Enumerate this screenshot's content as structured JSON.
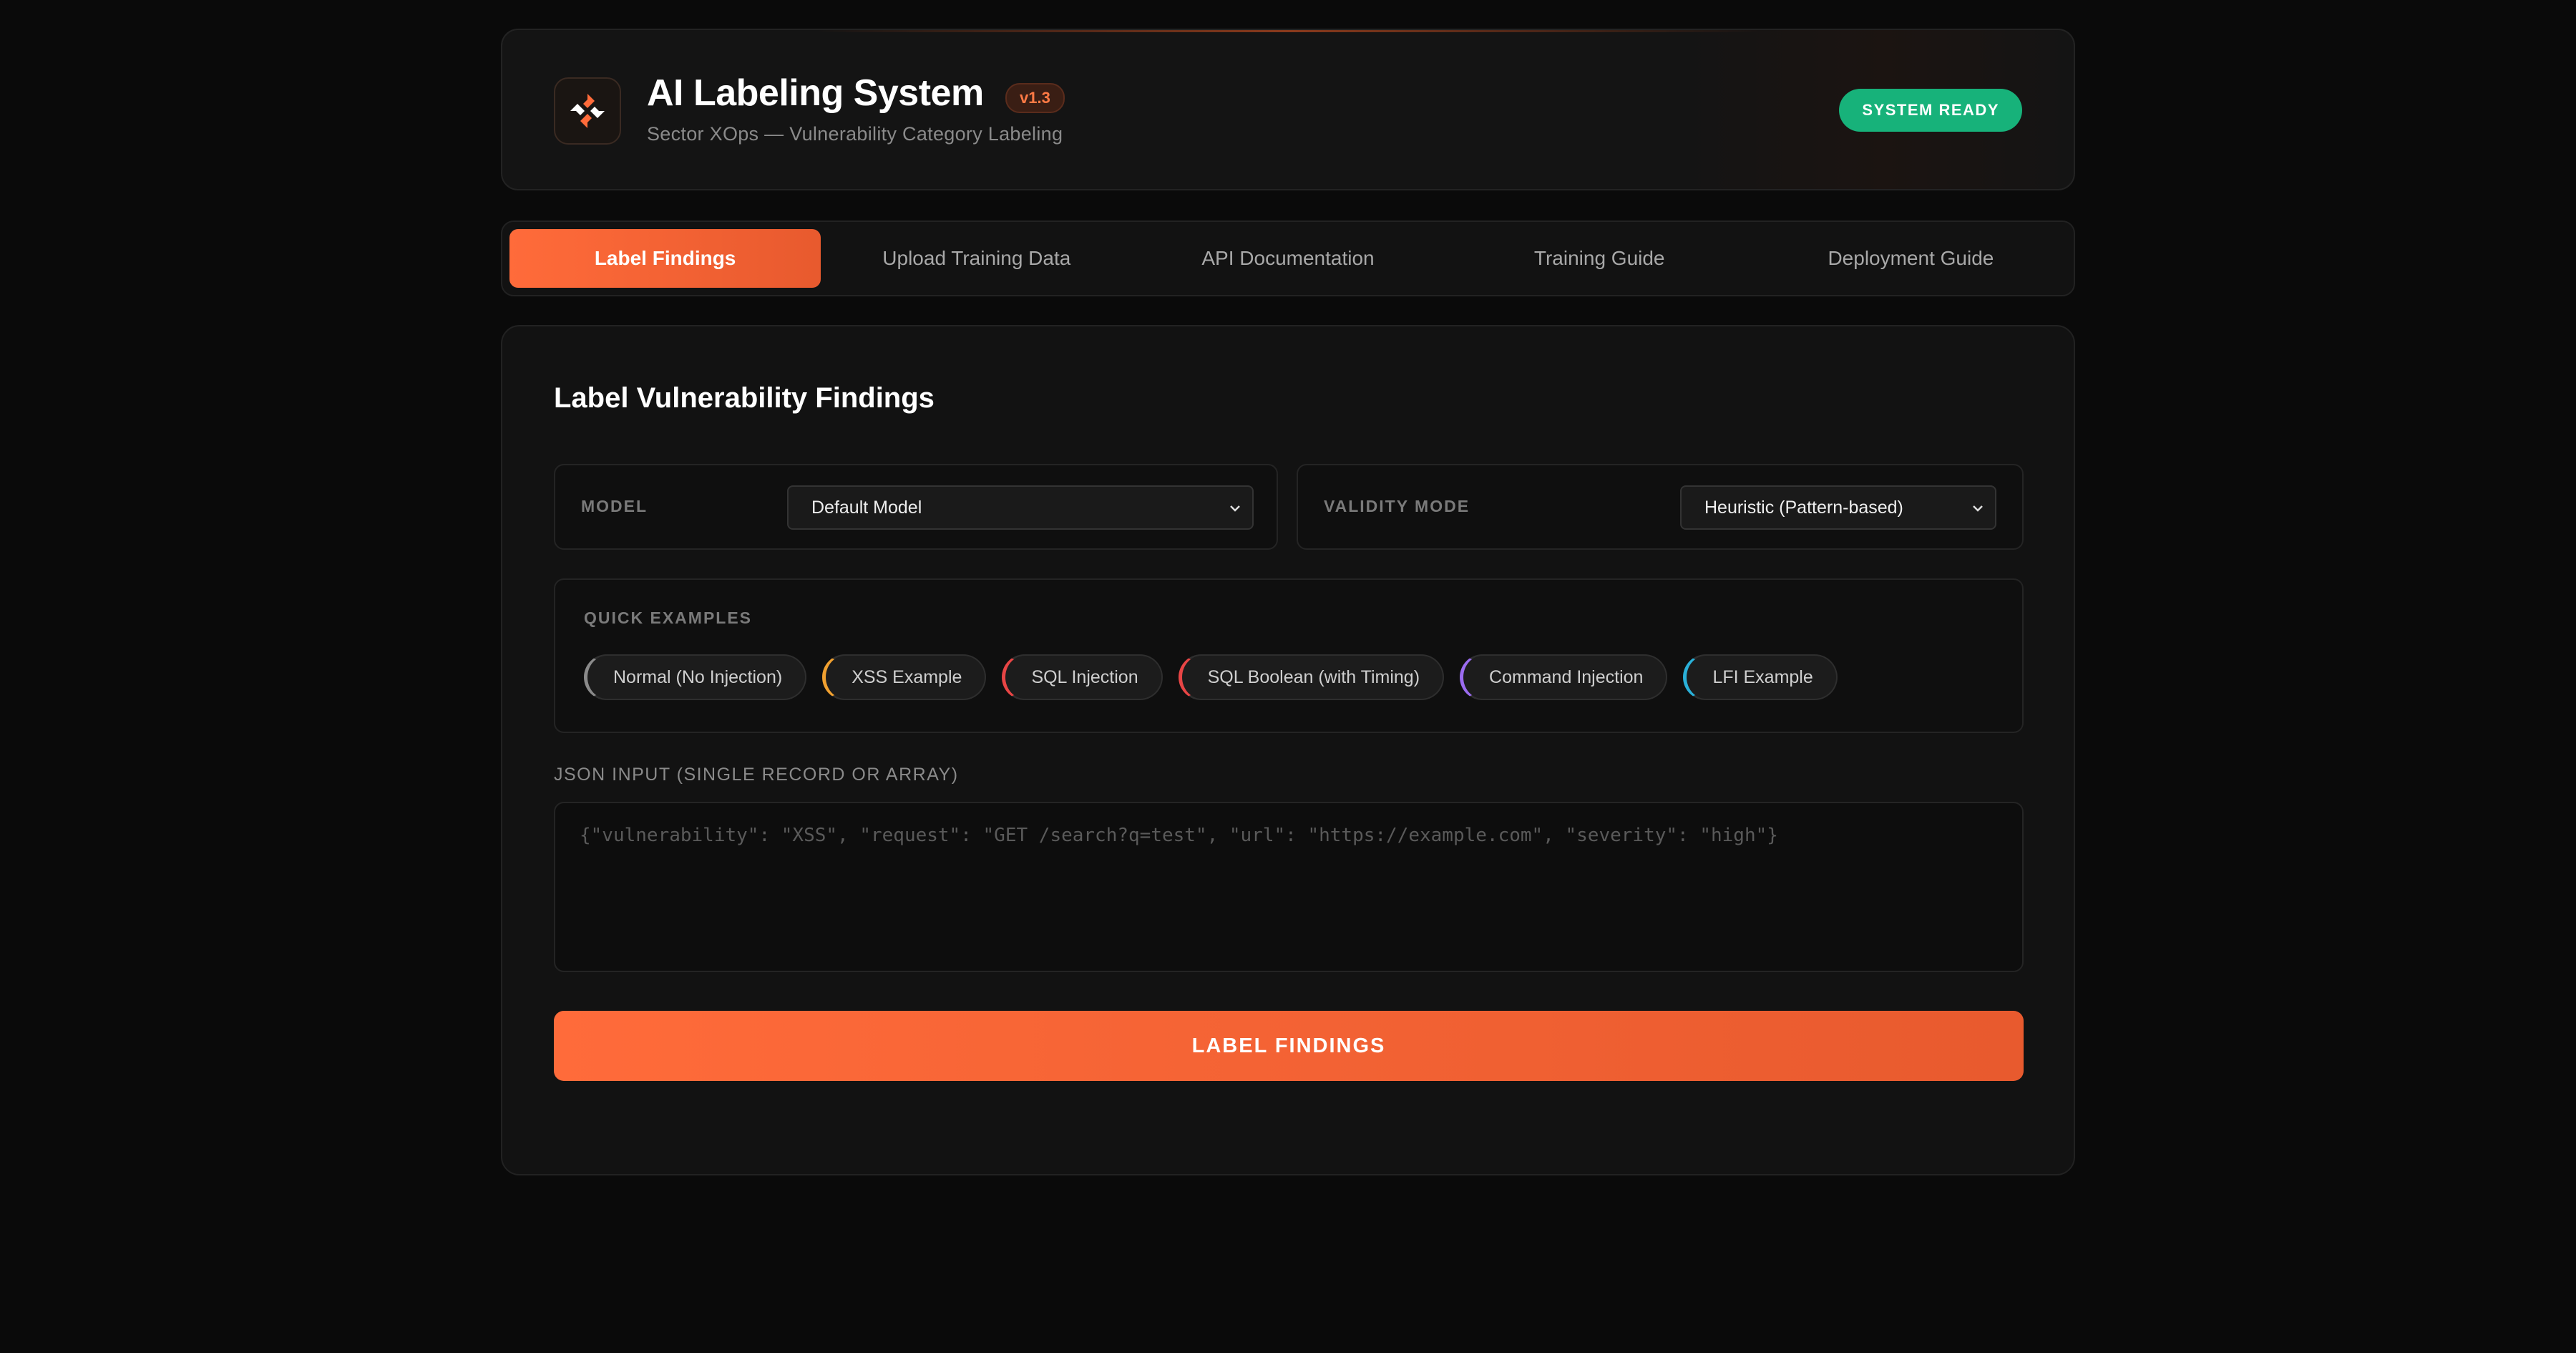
{
  "header": {
    "title": "AI Labeling System",
    "version": "v1.3",
    "subtitle": "Sector XOps — Vulnerability Category Labeling",
    "status": "SYSTEM READY",
    "logo_icon": "logo-icon"
  },
  "tabs": [
    {
      "label": "Label Findings",
      "active": true
    },
    {
      "label": "Upload Training Data",
      "active": false
    },
    {
      "label": "API Documentation",
      "active": false
    },
    {
      "label": "Training Guide",
      "active": false
    },
    {
      "label": "Deployment Guide",
      "active": false
    }
  ],
  "main": {
    "title": "Label Vulnerability Findings",
    "model": {
      "label": "MODEL",
      "selected": "Default Model"
    },
    "validity": {
      "label": "VALIDITY MODE",
      "selected": "Heuristic (Pattern-based)"
    },
    "quick_examples": {
      "label": "QUICK EXAMPLES",
      "items": [
        {
          "label": "Normal (No Injection)",
          "color": "#8a8a8a"
        },
        {
          "label": "XSS Example",
          "color": "#f0a030"
        },
        {
          "label": "SQL Injection",
          "color": "#e84545"
        },
        {
          "label": "SQL Boolean (with Timing)",
          "color": "#e84545"
        },
        {
          "label": "Command Injection",
          "color": "#9b6cf0"
        },
        {
          "label": "LFI Example",
          "color": "#2ab0d8"
        }
      ]
    },
    "json_input": {
      "label": "JSON INPUT (SINGLE RECORD OR ARRAY)",
      "placeholder": "{\"vulnerability\": \"XSS\", \"request\": \"GET /search?q=test\", \"url\": \"https://example.com\", \"severity\": \"high\"}",
      "value": ""
    },
    "submit_label": "LABEL FINDINGS"
  },
  "colors": {
    "accent": "#ff6b3a",
    "status": "#17b27a",
    "background": "#0a0a0a"
  }
}
